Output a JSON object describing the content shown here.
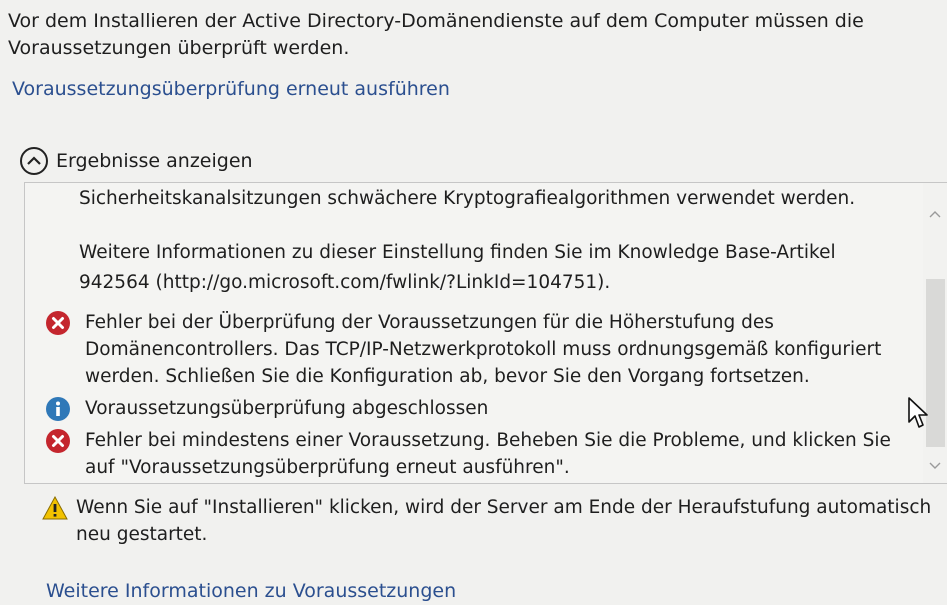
{
  "intro": {
    "line1": "Vor dem Installieren der Active Directory-Domänendienste auf dem Computer müssen die",
    "line2": "Voraussetzungen überprüft werden."
  },
  "rerun_link": "Voraussetzungsüberprüfung erneut ausführen",
  "results": {
    "toggle_label": "Ergebnisse anzeigen",
    "toggle_icon": "chevron-up-icon",
    "lines": {
      "crypto": "Sicherheitskanalsitzungen schwächere Kryptografiealgorithmen verwendet werden.",
      "kb1": "Weitere Informationen zu dieser Einstellung finden Sie im Knowledge Base-Artikel",
      "kb2": "942564 (http://go.microsoft.com/fwlink/?LinkId=104751)."
    },
    "messages": [
      {
        "icon": "error-icon",
        "line1": "Fehler bei der Überprüfung der Voraussetzungen für die Höherstufung des",
        "line2": "Domänencontrollers. Das TCP/IP-Netzwerkprotokoll muss ordnungsgemäß konfiguriert",
        "line3": "werden. Schließen Sie die Konfiguration ab, bevor Sie den Vorgang fortsetzen."
      },
      {
        "icon": "info-icon",
        "line1": "Voraussetzungsüberprüfung abgeschlossen"
      },
      {
        "icon": "error-icon",
        "line1": "Fehler bei mindestens einer Voraussetzung. Beheben Sie die Probleme, und klicken Sie",
        "line2": "auf \"Voraussetzungsüberprüfung erneut ausführen\"."
      }
    ]
  },
  "warning": {
    "icon": "warning-icon",
    "line1": "Wenn Sie auf \"Installieren\" klicken, wird der Server am Ende der Heraufstufung automatisch",
    "line2": "neu gestartet."
  },
  "more_link": "Weitere Informationen zu Voraussetzungen",
  "colors": {
    "link": "#2b4f8f",
    "error": "#c4262e",
    "info": "#2f78b8",
    "warning": "#f2c200",
    "background": "#f1f1ef"
  }
}
